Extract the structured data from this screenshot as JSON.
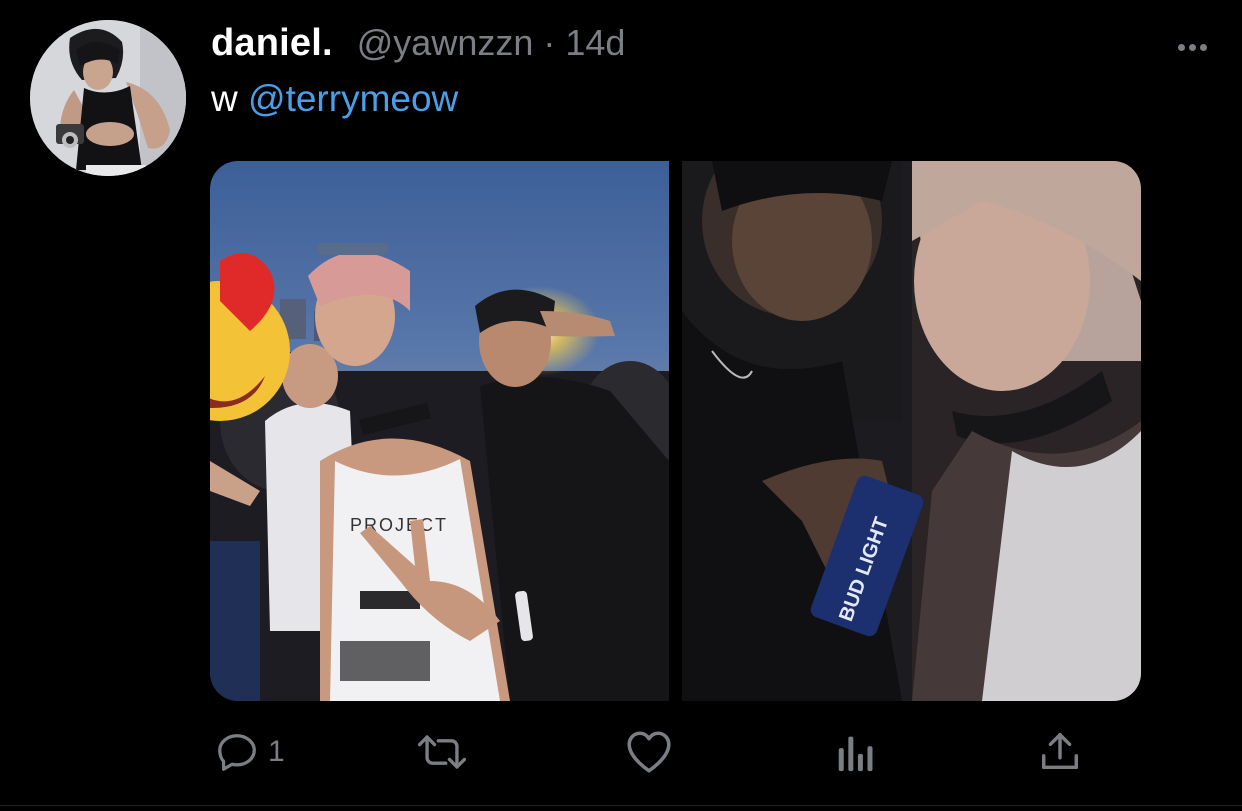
{
  "tweet": {
    "display_name": "daniel.",
    "handle": "@yawnzzn",
    "separator": "·",
    "time": "14d",
    "text_prefix": "w",
    "mention": "@terrymeow"
  },
  "actions": {
    "reply_count": "1"
  },
  "colors": {
    "background": "#000000",
    "text_primary": "#ffffff",
    "text_secondary": "#7b7f84",
    "link": "#4a9fe8"
  },
  "icons": {
    "reply": "reply-icon",
    "retweet": "retweet-icon",
    "like": "heart-icon",
    "views": "analytics-icon",
    "share": "share-icon",
    "more": "more-icon"
  }
}
